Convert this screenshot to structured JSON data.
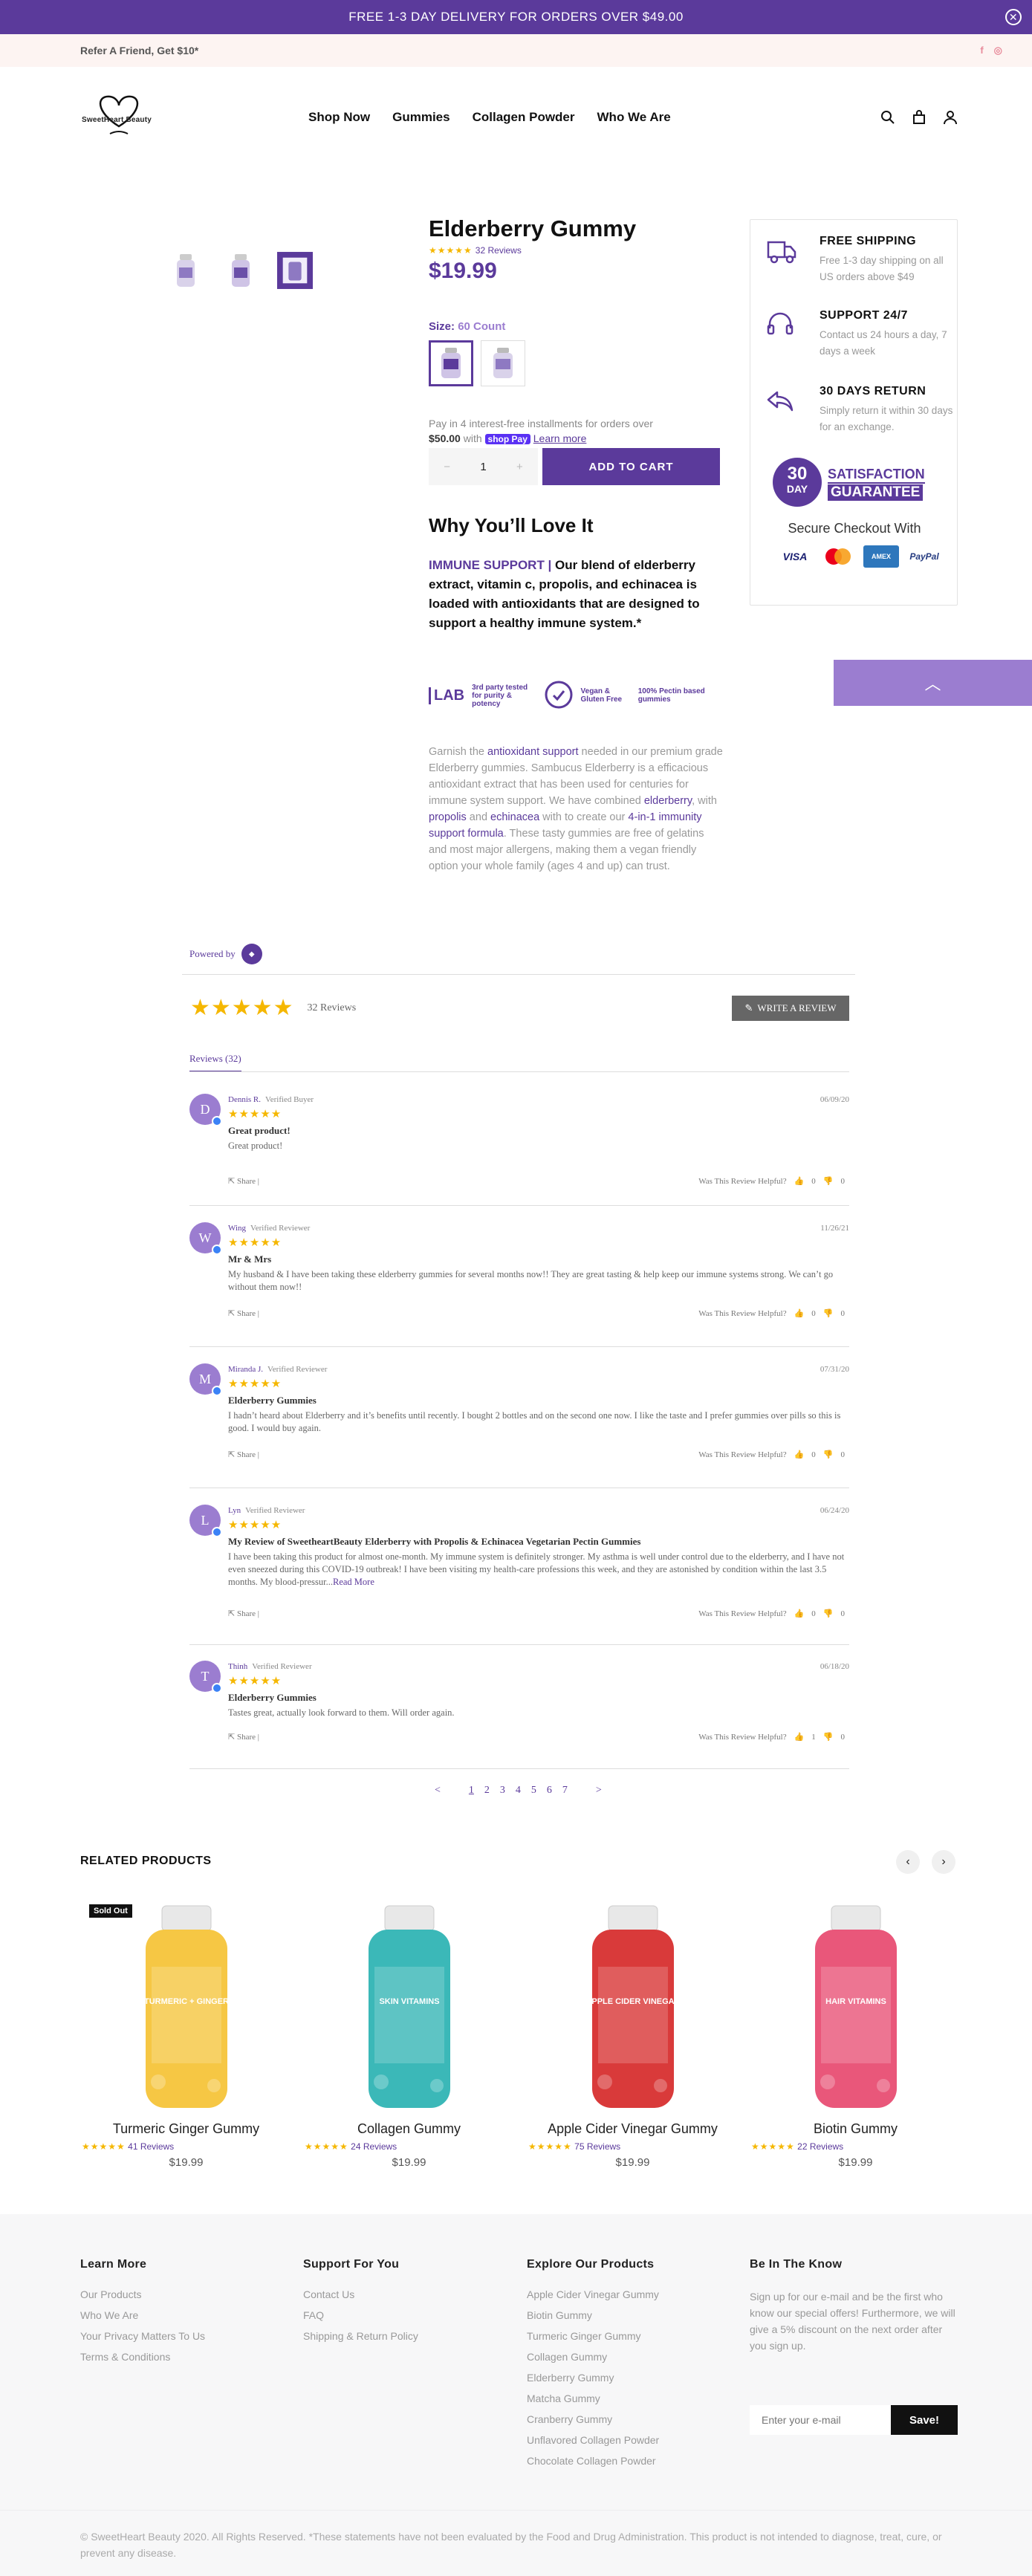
{
  "announcement": {
    "text": "FREE 1-3 DAY DELIVERY FOR ORDERS OVER $49.00",
    "close": "✕"
  },
  "topbar": {
    "refer": "Refer A Friend, Get $10*",
    "social": [
      "f",
      "◎"
    ]
  },
  "header": {
    "logo_text": "SweetHeart Beauty",
    "nav": [
      "Shop Now",
      "Gummies",
      "Collagen Powder",
      "Who We Are"
    ]
  },
  "product": {
    "title": "Elderberry Gummy",
    "stars": "★★★★★",
    "reviews_link": "32 Reviews",
    "price": "$19.99",
    "size_label": "Size:",
    "size_value": "60 Count",
    "pay_line1": "Pay in 4 interest-free installments for orders over",
    "pay_amount": "$50.00",
    "pay_with": "with",
    "shop_pay": "shop Pay",
    "learn_more": "Learn more",
    "qty_minus": "−",
    "qty_value": "1",
    "qty_plus": "+",
    "add_to_cart": "ADD TO CART",
    "why_title": "Why You’ll Love It",
    "immune_head": "IMMUNE SUPPORT |",
    "immune_body": " Our blend of elderberry extract, vitamin c, propolis, and echinacea is loaded with antioxidants that are designed to support a healthy immune system.*",
    "badges": [
      "3rd party tested for purity & potency",
      "Vegan & Gluten Free",
      "100% Pectin based gummies"
    ],
    "badge_lab": "LAB",
    "desc": [
      {
        "t": "Garnish the ",
        "h": false
      },
      {
        "t": "antioxidant support",
        "h": true
      },
      {
        "t": " needed in our premium grade Elderberry gummies. Sambucus Elderberry is a efficacious antioxidant extract that has been used for centuries for immune system support. We have combined ",
        "h": false
      },
      {
        "t": "elderberry",
        "h": true
      },
      {
        "t": ", with ",
        "h": false
      },
      {
        "t": "propolis",
        "h": true
      },
      {
        "t": " and ",
        "h": false
      },
      {
        "t": "echinacea",
        "h": true
      },
      {
        "t": " with to create our ",
        "h": false
      },
      {
        "t": "4-in-1 immunity support formula",
        "h": true
      },
      {
        "t": ". These tasty gummies are free of gelatins and most major allergens, making them a vegan friendly option your whole family (ages 4 and up) can trust.",
        "h": false
      }
    ]
  },
  "side": {
    "features": [
      {
        "title": "FREE SHIPPING",
        "desc": "Free 1-3 day shipping on all US orders above $49",
        "icon": "truck-icon"
      },
      {
        "title": "SUPPORT 24/7",
        "desc": "Contact us 24 hours a day, 7 days a week",
        "icon": "headset-icon"
      },
      {
        "title": "30 DAYS RETURN",
        "desc": "Simply return it within 30 days for an exchange.",
        "icon": "return-icon"
      }
    ],
    "guarantee_days": "30",
    "guarantee_day": "DAY",
    "guarantee_l1": "SATISFACTION",
    "guarantee_l2": "GUARANTEE",
    "secure": "Secure Checkout With",
    "cards": [
      "VISA",
      "MC",
      "AMEX",
      "PayPal"
    ]
  },
  "reviews": {
    "powered": "Powered by",
    "summary_stars": "★★★★★",
    "summary_count": "32 Reviews",
    "write": "WRITE A REVIEW",
    "tab": "Reviews (32)",
    "helpful": "Was This Review Helpful?",
    "share": "Share",
    "items": [
      {
        "initial": "D",
        "name": "Dennis R.",
        "badge": "Verified Buyer",
        "date": "06/09/20",
        "stars": "★★★★★",
        "title": "Great product!",
        "body": "Great product!",
        "more": "",
        "share_n": "|",
        "up": "0",
        "down": "0"
      },
      {
        "initial": "W",
        "name": "Wing",
        "badge": "Verified Reviewer",
        "date": "11/26/21",
        "stars": "★★★★★",
        "title": "Mr & Mrs",
        "body": "My husband & I have been taking these elderberry gummies for several months now!! They are great tasting & help keep our immune systems strong. We can’t go without them now!!",
        "more": "",
        "share_n": "|",
        "up": "0",
        "down": "0"
      },
      {
        "initial": "M",
        "name": "Miranda J.",
        "badge": "Verified Reviewer",
        "date": "07/31/20",
        "stars": "★★★★★",
        "title": "Elderberry Gummies",
        "body": "I hadn’t heard about Elderberry and it’s benefits until recently. I bought 2 bottles and on the second one now. I like the taste and I prefer gummies over pills so this is good. I would buy again.",
        "more": "",
        "share_n": "|",
        "up": "0",
        "down": "0"
      },
      {
        "initial": "L",
        "name": "Lyn",
        "badge": "Verified Reviewer",
        "date": "06/24/20",
        "stars": "★★★★★",
        "title": "My Review of SweetheartBeauty Elderberry with Propolis & Echinacea Vegetarian Pectin Gummies",
        "body": "I have been taking this product for almost one-month. My immune system is definitely stronger. My asthma is well under control due to the elderberry, and I have not even sneezed during this COVID-19 outbreak! I have been visiting my health-care professions this week, and they are astonished by condition within the last 3.5 months. My blood-pressur...",
        "more": "Read More",
        "share_n": "|",
        "up": "0",
        "down": "0"
      },
      {
        "initial": "T",
        "name": "Thinh",
        "badge": "Verified Reviewer",
        "date": "06/18/20",
        "stars": "★★★★★",
        "title": "Elderberry Gummies",
        "body": "Tastes great, actually look forward to them. Will order again.",
        "more": "",
        "share_n": "|",
        "up": "1",
        "down": "0"
      }
    ],
    "pager": {
      "prev": "<",
      "pages": [
        "1",
        "2",
        "3",
        "4",
        "5",
        "6",
        "7"
      ],
      "next": ">"
    }
  },
  "related": {
    "title": "RELATED PRODUCTS",
    "prev": "‹",
    "next": "›",
    "items": [
      {
        "name": "Turmeric Ginger Gummy",
        "stars": "★★★★★",
        "reviews": "41 Reviews",
        "price": "$19.99",
        "sold_out": "Sold Out",
        "color": "#f6c744",
        "label": "TURMERIC + GINGER"
      },
      {
        "name": "Collagen Gummy",
        "stars": "★★★★★",
        "reviews": "24 Reviews",
        "price": "$19.99",
        "sold_out": "",
        "color": "#3bb8b8",
        "label": "SKIN VITAMINS"
      },
      {
        "name": "Apple Cider Vinegar Gummy",
        "stars": "★★★★★",
        "reviews": "75 Reviews",
        "price": "$19.99",
        "sold_out": "",
        "color": "#d93a3a",
        "label": "APPLE CIDER VINEGAR"
      },
      {
        "name": "Biotin Gummy",
        "stars": "★★★★★",
        "reviews": "22 Reviews",
        "price": "$19.99",
        "sold_out": "",
        "color": "#e9577a",
        "label": "HAIR VITAMINS"
      }
    ]
  },
  "footer": {
    "learn": {
      "title": "Learn More",
      "links": [
        "Our Products",
        "Who We Are",
        "Your Privacy Matters To Us",
        "Terms & Conditions"
      ]
    },
    "support": {
      "title": "Support For You",
      "links": [
        "Contact Us",
        "FAQ",
        "Shipping & Return Policy"
      ]
    },
    "explore": {
      "title": "Explore Our Products",
      "links": [
        "Apple Cider Vinegar Gummy",
        "Biotin Gummy",
        "Turmeric Ginger Gummy",
        "Collagen Gummy",
        "Elderberry Gummy",
        "Matcha Gummy",
        "Cranberry Gummy",
        "Unflavored Collagen Powder",
        "Chocolate Collagen Powder"
      ]
    },
    "news": {
      "title": "Be In The Know",
      "text": "Sign up for our e-mail and be the first who know our special offers! Furthermore, we will give a 5% discount on the next order after you sign up.",
      "placeholder": "Enter your e-mail",
      "button": "Save!"
    },
    "copyright": "© SweetHeart Beauty 2020. All Rights Reserved. *These statements have not been evaluated by the Food and Drug Administration. This product is not intended to diagnose, treat, cure, or prevent any disease."
  }
}
